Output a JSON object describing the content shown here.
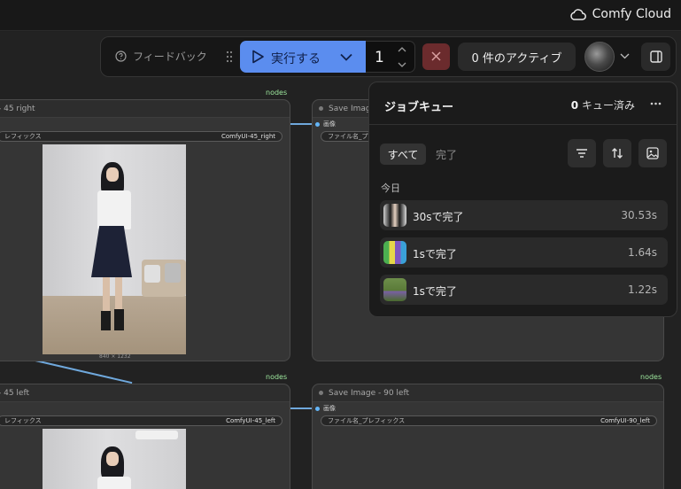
{
  "app": {
    "brand": "Comfy Cloud"
  },
  "toolbar": {
    "feedback_label": "フィードバック",
    "run_label": "実行する",
    "batch_count": "1",
    "active_label": "0 件のアクティブ"
  },
  "canvas": {
    "nodes": [
      {
        "id": "left-top",
        "title": "- 45 right",
        "field_label": "レフィックス",
        "field_value": "ComfyUI-45_right",
        "dims": "840 × 1232",
        "tag": "nodes"
      },
      {
        "id": "right-top",
        "title": "Save Image",
        "input_label": "画像",
        "field_label": "ファイル名_プ",
        "tag": ""
      },
      {
        "id": "left-bottom",
        "title": "- 45 left",
        "field_label": "レフィックス",
        "field_value": "ComfyUI-45_left",
        "tag": "nodes"
      },
      {
        "id": "right-bottom",
        "title": "Save Image - 90 left",
        "input_label": "画像",
        "field_label": "ファイル名_プレフィックス",
        "field_value": "ComfyUI-90_left",
        "tag": "nodes"
      }
    ]
  },
  "queue": {
    "title": "ジョブキュー",
    "queued_count": "0",
    "queued_suffix": "キュー済み",
    "tabs": [
      {
        "label": "すべて",
        "active": true
      },
      {
        "label": "完了",
        "active": false
      }
    ],
    "section_label": "今日",
    "jobs": [
      {
        "label": "30sで完了",
        "duration": "30.53s",
        "thumb": "portrait"
      },
      {
        "label": "1sで完了",
        "duration": "1.64s",
        "thumb": "bottles"
      },
      {
        "label": "1sで完了",
        "duration": "1.22s",
        "thumb": "landscape"
      }
    ]
  },
  "colors": {
    "run_button": "#5b8def",
    "stop_button": "#6b2b2d",
    "link": "#6fa8dc",
    "nodes_tag": "#9ee89e"
  }
}
